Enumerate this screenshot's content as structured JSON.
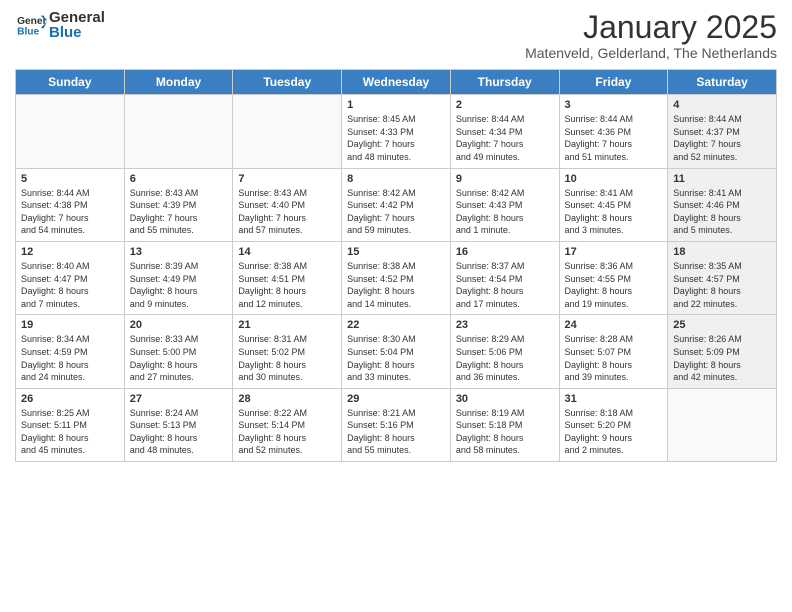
{
  "header": {
    "logo_general": "General",
    "logo_blue": "Blue",
    "month_title": "January 2025",
    "location": "Matenveld, Gelderland, The Netherlands"
  },
  "weekdays": [
    "Sunday",
    "Monday",
    "Tuesday",
    "Wednesday",
    "Thursday",
    "Friday",
    "Saturday"
  ],
  "weeks": [
    [
      {
        "day": "",
        "info": "",
        "shaded": false,
        "empty": true
      },
      {
        "day": "",
        "info": "",
        "shaded": false,
        "empty": true
      },
      {
        "day": "",
        "info": "",
        "shaded": false,
        "empty": true
      },
      {
        "day": "1",
        "info": "Sunrise: 8:45 AM\nSunset: 4:33 PM\nDaylight: 7 hours\nand 48 minutes.",
        "shaded": false,
        "empty": false
      },
      {
        "day": "2",
        "info": "Sunrise: 8:44 AM\nSunset: 4:34 PM\nDaylight: 7 hours\nand 49 minutes.",
        "shaded": false,
        "empty": false
      },
      {
        "day": "3",
        "info": "Sunrise: 8:44 AM\nSunset: 4:36 PM\nDaylight: 7 hours\nand 51 minutes.",
        "shaded": false,
        "empty": false
      },
      {
        "day": "4",
        "info": "Sunrise: 8:44 AM\nSunset: 4:37 PM\nDaylight: 7 hours\nand 52 minutes.",
        "shaded": true,
        "empty": false
      }
    ],
    [
      {
        "day": "5",
        "info": "Sunrise: 8:44 AM\nSunset: 4:38 PM\nDaylight: 7 hours\nand 54 minutes.",
        "shaded": false,
        "empty": false
      },
      {
        "day": "6",
        "info": "Sunrise: 8:43 AM\nSunset: 4:39 PM\nDaylight: 7 hours\nand 55 minutes.",
        "shaded": false,
        "empty": false
      },
      {
        "day": "7",
        "info": "Sunrise: 8:43 AM\nSunset: 4:40 PM\nDaylight: 7 hours\nand 57 minutes.",
        "shaded": false,
        "empty": false
      },
      {
        "day": "8",
        "info": "Sunrise: 8:42 AM\nSunset: 4:42 PM\nDaylight: 7 hours\nand 59 minutes.",
        "shaded": false,
        "empty": false
      },
      {
        "day": "9",
        "info": "Sunrise: 8:42 AM\nSunset: 4:43 PM\nDaylight: 8 hours\nand 1 minute.",
        "shaded": false,
        "empty": false
      },
      {
        "day": "10",
        "info": "Sunrise: 8:41 AM\nSunset: 4:45 PM\nDaylight: 8 hours\nand 3 minutes.",
        "shaded": false,
        "empty": false
      },
      {
        "day": "11",
        "info": "Sunrise: 8:41 AM\nSunset: 4:46 PM\nDaylight: 8 hours\nand 5 minutes.",
        "shaded": true,
        "empty": false
      }
    ],
    [
      {
        "day": "12",
        "info": "Sunrise: 8:40 AM\nSunset: 4:47 PM\nDaylight: 8 hours\nand 7 minutes.",
        "shaded": false,
        "empty": false
      },
      {
        "day": "13",
        "info": "Sunrise: 8:39 AM\nSunset: 4:49 PM\nDaylight: 8 hours\nand 9 minutes.",
        "shaded": false,
        "empty": false
      },
      {
        "day": "14",
        "info": "Sunrise: 8:38 AM\nSunset: 4:51 PM\nDaylight: 8 hours\nand 12 minutes.",
        "shaded": false,
        "empty": false
      },
      {
        "day": "15",
        "info": "Sunrise: 8:38 AM\nSunset: 4:52 PM\nDaylight: 8 hours\nand 14 minutes.",
        "shaded": false,
        "empty": false
      },
      {
        "day": "16",
        "info": "Sunrise: 8:37 AM\nSunset: 4:54 PM\nDaylight: 8 hours\nand 17 minutes.",
        "shaded": false,
        "empty": false
      },
      {
        "day": "17",
        "info": "Sunrise: 8:36 AM\nSunset: 4:55 PM\nDaylight: 8 hours\nand 19 minutes.",
        "shaded": false,
        "empty": false
      },
      {
        "day": "18",
        "info": "Sunrise: 8:35 AM\nSunset: 4:57 PM\nDaylight: 8 hours\nand 22 minutes.",
        "shaded": true,
        "empty": false
      }
    ],
    [
      {
        "day": "19",
        "info": "Sunrise: 8:34 AM\nSunset: 4:59 PM\nDaylight: 8 hours\nand 24 minutes.",
        "shaded": false,
        "empty": false
      },
      {
        "day": "20",
        "info": "Sunrise: 8:33 AM\nSunset: 5:00 PM\nDaylight: 8 hours\nand 27 minutes.",
        "shaded": false,
        "empty": false
      },
      {
        "day": "21",
        "info": "Sunrise: 8:31 AM\nSunset: 5:02 PM\nDaylight: 8 hours\nand 30 minutes.",
        "shaded": false,
        "empty": false
      },
      {
        "day": "22",
        "info": "Sunrise: 8:30 AM\nSunset: 5:04 PM\nDaylight: 8 hours\nand 33 minutes.",
        "shaded": false,
        "empty": false
      },
      {
        "day": "23",
        "info": "Sunrise: 8:29 AM\nSunset: 5:06 PM\nDaylight: 8 hours\nand 36 minutes.",
        "shaded": false,
        "empty": false
      },
      {
        "day": "24",
        "info": "Sunrise: 8:28 AM\nSunset: 5:07 PM\nDaylight: 8 hours\nand 39 minutes.",
        "shaded": false,
        "empty": false
      },
      {
        "day": "25",
        "info": "Sunrise: 8:26 AM\nSunset: 5:09 PM\nDaylight: 8 hours\nand 42 minutes.",
        "shaded": true,
        "empty": false
      }
    ],
    [
      {
        "day": "26",
        "info": "Sunrise: 8:25 AM\nSunset: 5:11 PM\nDaylight: 8 hours\nand 45 minutes.",
        "shaded": false,
        "empty": false
      },
      {
        "day": "27",
        "info": "Sunrise: 8:24 AM\nSunset: 5:13 PM\nDaylight: 8 hours\nand 48 minutes.",
        "shaded": false,
        "empty": false
      },
      {
        "day": "28",
        "info": "Sunrise: 8:22 AM\nSunset: 5:14 PM\nDaylight: 8 hours\nand 52 minutes.",
        "shaded": false,
        "empty": false
      },
      {
        "day": "29",
        "info": "Sunrise: 8:21 AM\nSunset: 5:16 PM\nDaylight: 8 hours\nand 55 minutes.",
        "shaded": false,
        "empty": false
      },
      {
        "day": "30",
        "info": "Sunrise: 8:19 AM\nSunset: 5:18 PM\nDaylight: 8 hours\nand 58 minutes.",
        "shaded": false,
        "empty": false
      },
      {
        "day": "31",
        "info": "Sunrise: 8:18 AM\nSunset: 5:20 PM\nDaylight: 9 hours\nand 2 minutes.",
        "shaded": false,
        "empty": false
      },
      {
        "day": "",
        "info": "",
        "shaded": true,
        "empty": true
      }
    ]
  ]
}
